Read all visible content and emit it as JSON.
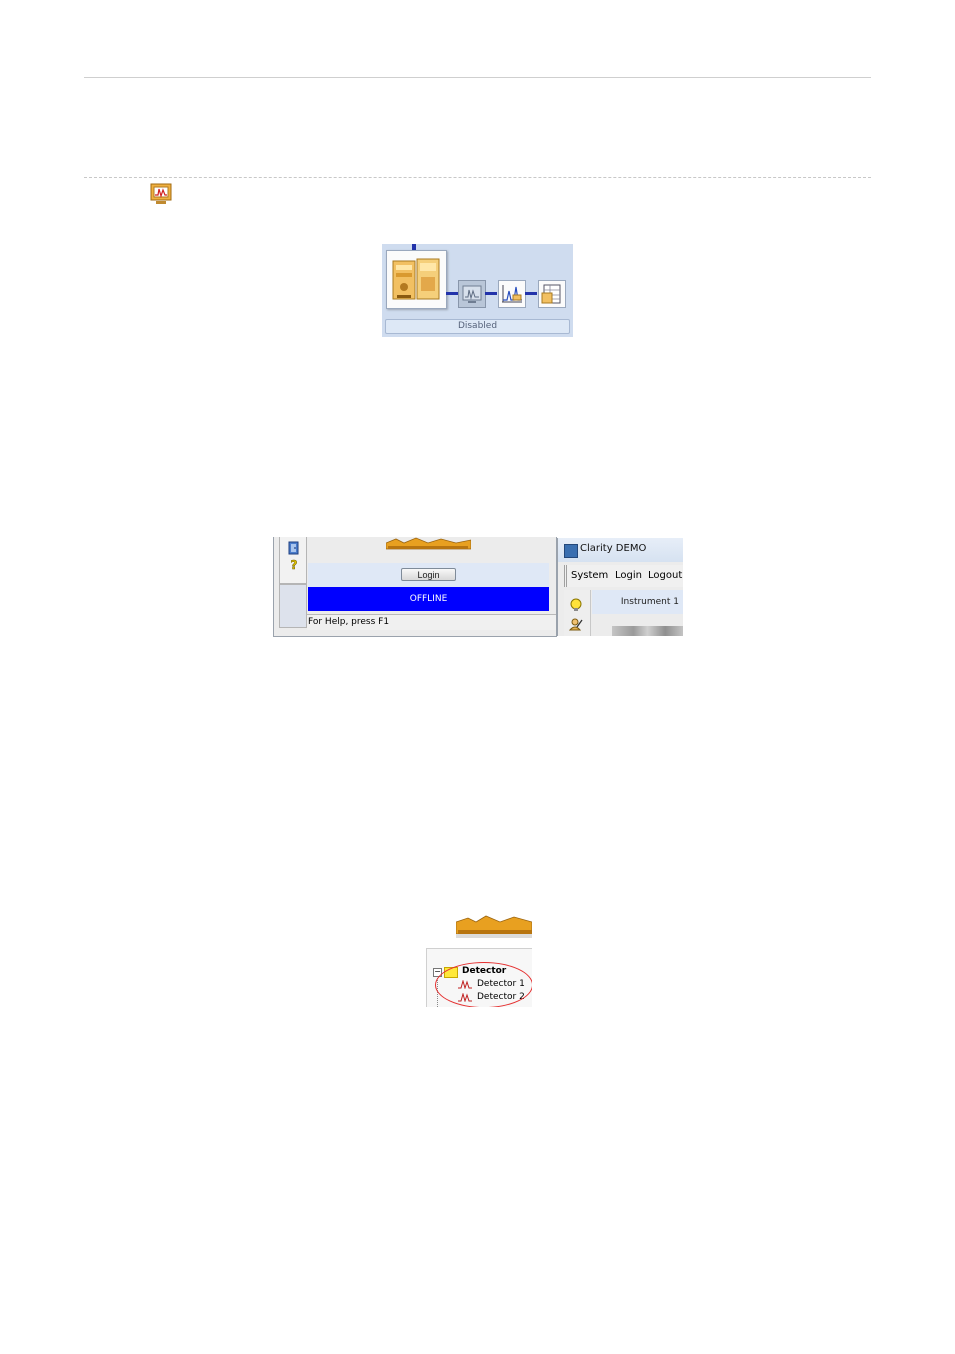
{
  "figure1": {
    "status_label": "Disabled",
    "icons": [
      "instrument-icon",
      "monitor-icon",
      "chromatogram-icon",
      "calibration-icon"
    ],
    "colors": {
      "panel_bg": "#cfdcef",
      "link": "#2233aa"
    }
  },
  "figure2": {
    "login_button": "Login",
    "offline_text": "OFFLINE",
    "status_bar": "For Help, press F1",
    "window_title": "Clarity DEMO",
    "menu": {
      "system": "System",
      "login": "Login",
      "logout": "Logout"
    },
    "instrument_label": "Instrument 1",
    "colors": {
      "offline_bg": "#0000ff",
      "offline_fg": "#ffffff"
    }
  },
  "figure3": {
    "folder_label": "Detector",
    "items": [
      "Detector 1",
      "Detector 2"
    ],
    "colors": {
      "highlight_circle": "#e53030",
      "folder": "#ffe83a"
    }
  }
}
